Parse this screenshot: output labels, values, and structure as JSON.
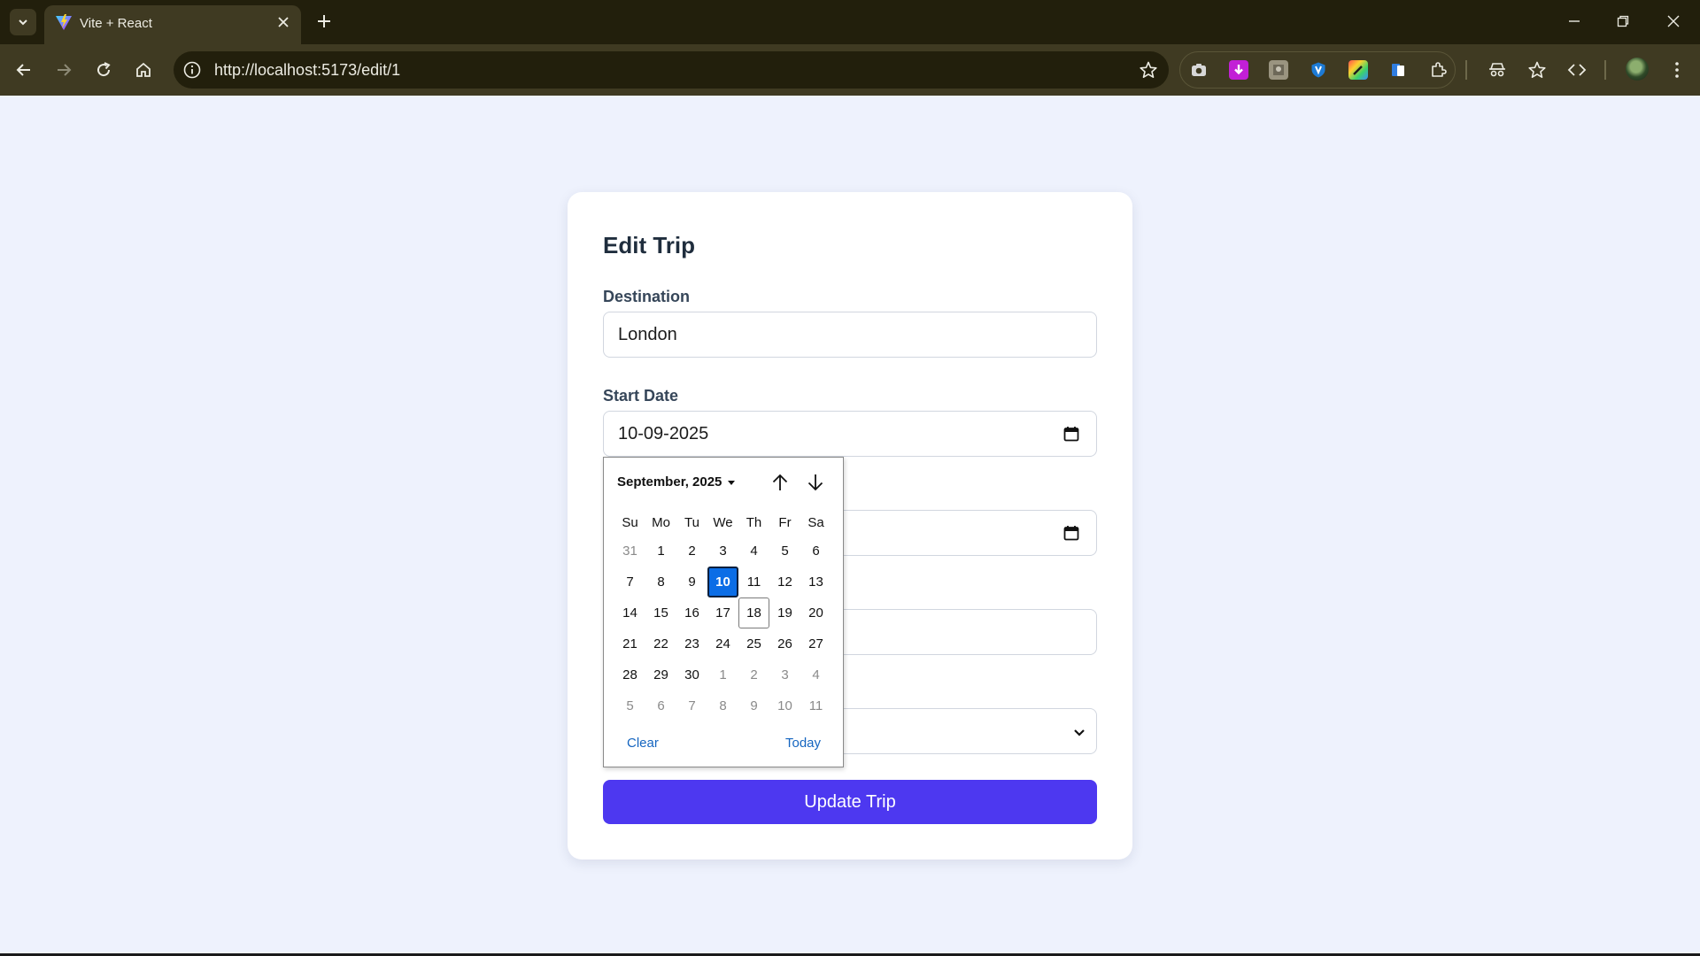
{
  "browser": {
    "tab_title": "Vite + React",
    "url": "http://localhost:5173/edit/1"
  },
  "form": {
    "title": "Edit Trip",
    "destination_label": "Destination",
    "destination_value": "London",
    "start_date_label": "Start Date",
    "start_date_value": "10-09-2025",
    "submit_label": "Update Trip"
  },
  "datepicker": {
    "month_label": "September, 2025",
    "weekdays": [
      "Su",
      "Mo",
      "Tu",
      "We",
      "Th",
      "Fr",
      "Sa"
    ],
    "weeks": [
      [
        "31",
        "1",
        "2",
        "3",
        "4",
        "5",
        "6"
      ],
      [
        "7",
        "8",
        "9",
        "10",
        "11",
        "12",
        "13"
      ],
      [
        "14",
        "15",
        "16",
        "17",
        "18",
        "19",
        "20"
      ],
      [
        "21",
        "22",
        "23",
        "24",
        "25",
        "26",
        "27"
      ],
      [
        "28",
        "29",
        "30",
        "1",
        "2",
        "3",
        "4"
      ],
      [
        "5",
        "6",
        "7",
        "8",
        "9",
        "10",
        "11"
      ]
    ],
    "selected_day": "10",
    "today_day": "18",
    "clear_label": "Clear",
    "today_label": "Today"
  },
  "colors": {
    "page_background": "#eef2fd",
    "primary_button": "#4d38f0",
    "selected_day": "#0b6de6",
    "link": "#1565c0"
  },
  "icons": [
    "tab-search-icon",
    "vite-logo-icon",
    "close-icon",
    "plus-icon",
    "back-icon",
    "forward-icon",
    "reload-icon",
    "home-icon",
    "info-icon",
    "star-icon",
    "camera-icon",
    "download-icon",
    "calendar-icon",
    "chevron-down-icon",
    "arrow-up-icon",
    "arrow-down-icon"
  ]
}
